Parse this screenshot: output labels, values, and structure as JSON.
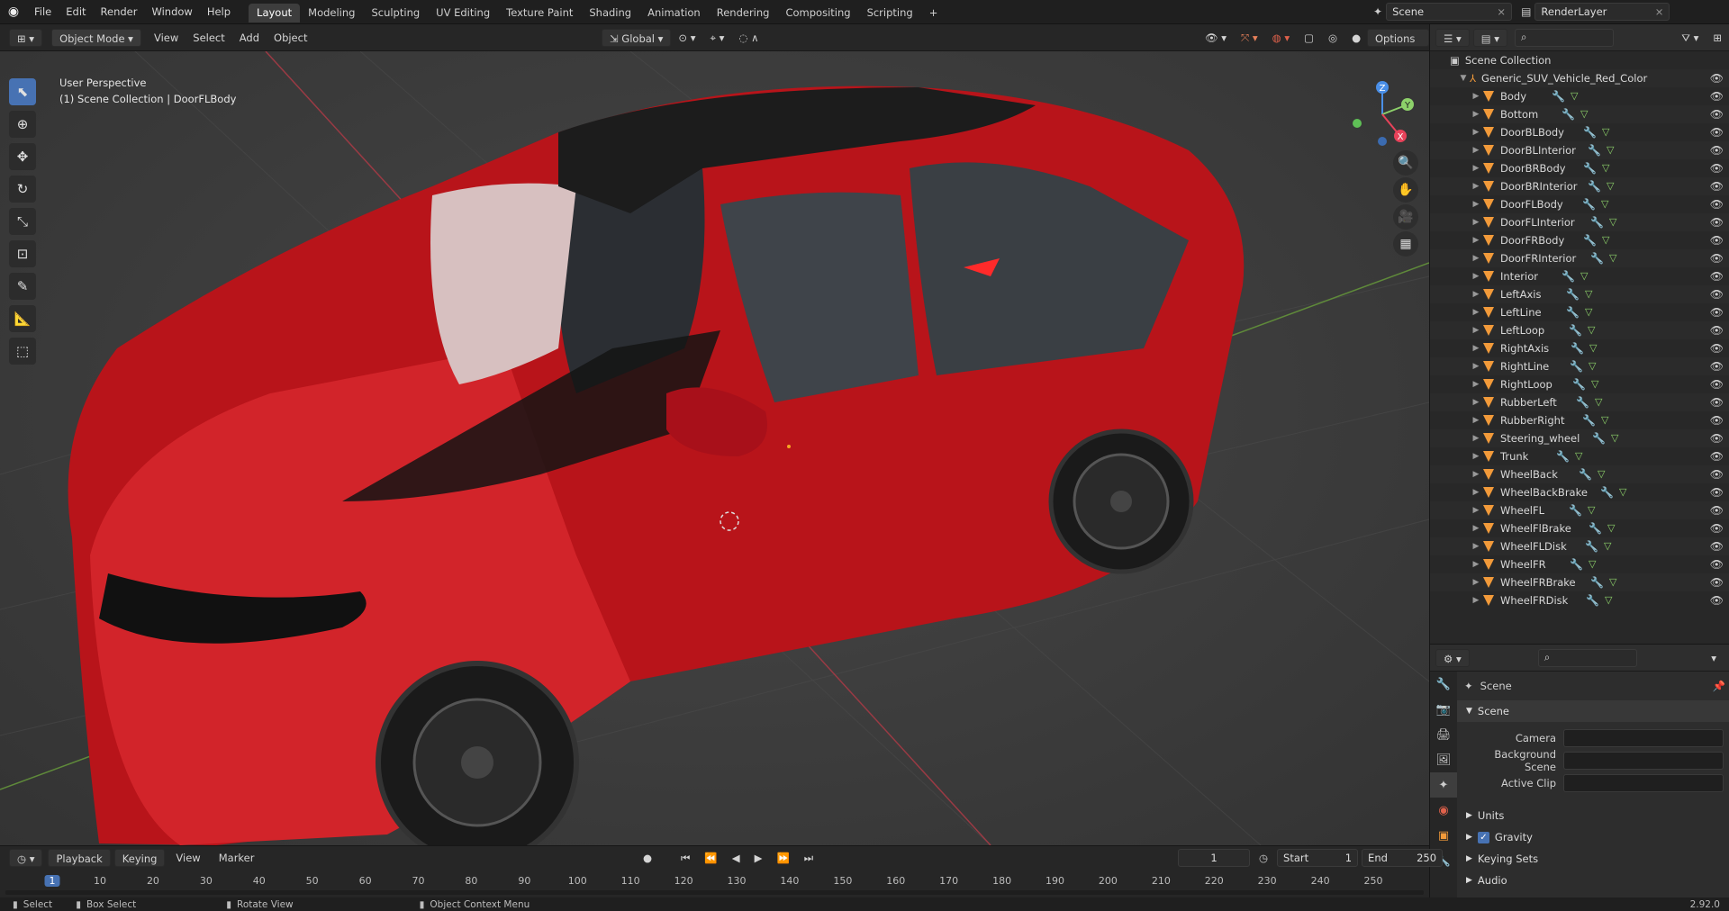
{
  "menus": [
    "File",
    "Edit",
    "Render",
    "Window",
    "Help"
  ],
  "workspaces": [
    {
      "label": "Layout",
      "active": true
    },
    {
      "label": "Modeling"
    },
    {
      "label": "Sculpting"
    },
    {
      "label": "UV Editing"
    },
    {
      "label": "Texture Paint"
    },
    {
      "label": "Shading"
    },
    {
      "label": "Animation"
    },
    {
      "label": "Rendering"
    },
    {
      "label": "Compositing"
    },
    {
      "label": "Scripting"
    }
  ],
  "add_workspace": "+",
  "scene": "Scene",
  "view_layer": "RenderLayer",
  "viewport": {
    "mode": "Object Mode",
    "menus": [
      "View",
      "Select",
      "Add",
      "Object"
    ],
    "transform": "Global",
    "options": "Options",
    "perspective": "User Perspective",
    "collection_info": "(1) Scene Collection | DoorFLBody",
    "gizmo": {
      "x": "X",
      "y": "Y",
      "z": "Z"
    }
  },
  "outliner": {
    "root": "Scene Collection",
    "object": "Generic_SUV_Vehicle_Red_Color",
    "items": [
      "Body",
      "Bottom",
      "DoorBLBody",
      "DoorBLInterior",
      "DoorBRBody",
      "DoorBRInterior",
      "DoorFLBody",
      "DoorFLInterior",
      "DoorFRBody",
      "DoorFRInterior",
      "Interior",
      "LeftAxis",
      "LeftLine",
      "LeftLoop",
      "RightAxis",
      "RightLine",
      "RightLoop",
      "RubberLeft",
      "RubberRight",
      "Steering_wheel",
      "Trunk",
      "WheelBack",
      "WheelBackBrake",
      "WheelFL",
      "WheelFlBrake",
      "WheelFLDisk",
      "WheelFR",
      "WheelFRBrake",
      "WheelFRDisk"
    ]
  },
  "properties": {
    "context": "Scene",
    "panel": "Scene",
    "camera_label": "Camera",
    "background_label": "Background Scene",
    "clip_label": "Active Clip",
    "units": "Units",
    "gravity": "Gravity",
    "gravity_checked": true,
    "keying_sets": "Keying Sets",
    "audio": "Audio"
  },
  "timeline": {
    "menus": [
      "Playback",
      "Keying",
      "View",
      "Marker"
    ],
    "current_frame": "1",
    "start_label": "Start",
    "start": "1",
    "end_label": "End",
    "end": "250",
    "ticks": [
      "1",
      "10",
      "20",
      "30",
      "40",
      "50",
      "60",
      "70",
      "80",
      "90",
      "100",
      "110",
      "120",
      "130",
      "140",
      "150",
      "160",
      "170",
      "180",
      "190",
      "200",
      "210",
      "220",
      "230",
      "240",
      "250"
    ]
  },
  "status": {
    "select": "Select",
    "box_select": "Box Select",
    "rotate": "Rotate View",
    "context": "Object Context Menu",
    "version": "2.92.0"
  },
  "colors": {
    "accent": "#4772b3",
    "car_red": "#c8141a",
    "mesh": "#f29a3a",
    "x_axis": "#e8425a",
    "y_axis": "#8dd16a",
    "z_axis": "#4a8fe7"
  }
}
